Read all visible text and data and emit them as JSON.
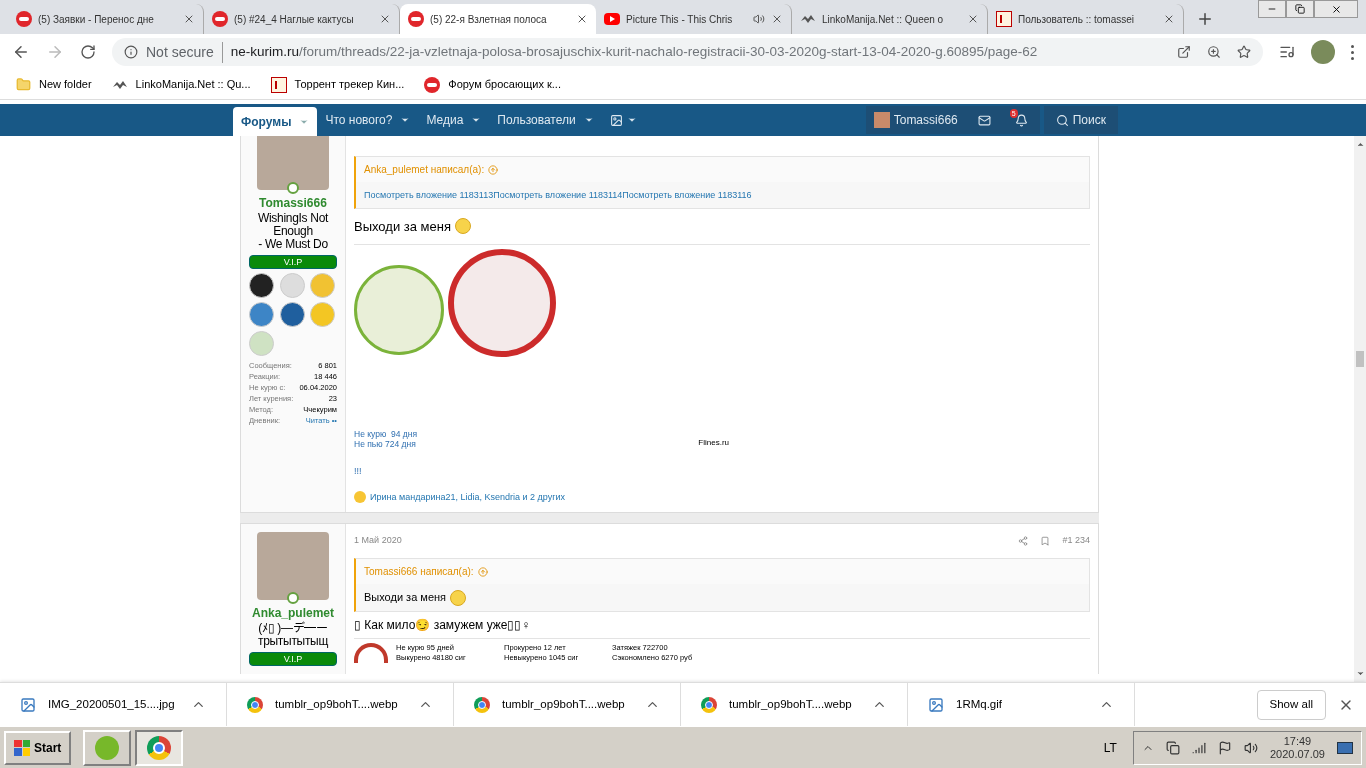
{
  "browser": {
    "tabs": [
      {
        "title": "(5) Заявки - Перенос дне",
        "kind": "forum",
        "selected": false,
        "audio": false
      },
      {
        "title": "(5) #24_4 Наглые кактусы",
        "kind": "forum",
        "selected": false,
        "audio": false
      },
      {
        "title": "(5) 22-я Взлетная полоса",
        "kind": "forum",
        "selected": true,
        "audio": false
      },
      {
        "title": "Picture This - This Chris",
        "kind": "video",
        "selected": false,
        "audio": true
      },
      {
        "title": "LinkoManija.Net :: Queen o",
        "kind": "site",
        "selected": false,
        "audio": false
      },
      {
        "title": "Пользователь :: tomassei",
        "kind": "letter",
        "selected": false,
        "audio": false
      }
    ],
    "security": "Not secure",
    "host": "ne-kurim.ru",
    "path": "/forum/threads/22-ja-vzletnaja-polosa-brosajuschix-kurit-nachalo-registracii-30-03-2020g-start-13-04-2020-g.60895/page-62",
    "bookmarks": [
      {
        "label": "New folder",
        "kind": "folder"
      },
      {
        "label": "LinkoManija.Net :: Qu...",
        "kind": "site"
      },
      {
        "label": "Торрент трекер Кин...",
        "kind": "letter"
      },
      {
        "label": "Форум бросающих к...",
        "kind": "forum"
      }
    ]
  },
  "forum_nav": {
    "items": [
      {
        "label": "Форумы",
        "selected": true
      },
      {
        "label": "Что нового?",
        "selected": false
      },
      {
        "label": "Медиа",
        "selected": false
      },
      {
        "label": "Пользователи",
        "selected": false
      }
    ],
    "user": "Tomassi666",
    "alerts_count": "5",
    "search": "Поиск"
  },
  "posts": [
    {
      "author": {
        "name": "Tomassi666",
        "title_lines": [
          "WishingIs Not Enough",
          "- We Must Do"
        ],
        "badge": "V.I.P",
        "awards": [
          {
            "kind": "hand"
          },
          {
            "kind": "mask"
          },
          {
            "kind": "banana"
          },
          {
            "kind": "person"
          },
          {
            "kind": "megaphone"
          },
          {
            "kind": "medal"
          },
          {
            "kind": "flower"
          }
        ],
        "stats": [
          {
            "label": "Сообщения:",
            "value": "6 801",
            "link": false
          },
          {
            "label": "Реакции:",
            "value": "18 446",
            "link": false
          },
          {
            "label": "Не курю с:",
            "value": "06.04.2020",
            "link": false
          },
          {
            "label": "Лет курения:",
            "value": "23",
            "link": false
          },
          {
            "label": "Метод:",
            "value": "Ччекурим",
            "link": false
          },
          {
            "label": "Дневник:",
            "value": "Читать ••",
            "link": true
          }
        ]
      },
      "quote": {
        "author": "Anka_pulemet написал(а):",
        "body": "Посмотреть вложение 1183113Посмотреть вложение 1183114Посмотреть вложение 1183116",
        "body_link": true
      },
      "text": "Выходи за меня",
      "images": [
        {
          "kind": "cactus"
        },
        {
          "kind": "stamp"
        }
      ],
      "signature": {
        "lines": [
          "Не курю  94 дня",
          "Не пью 724 дня"
        ],
        "site": "Flines.ru"
      },
      "extra": "!!!",
      "reactions": "Ирина мандарина21, Lidia, Ksendria и 2 других"
    },
    {
      "date": "1 Май 2020",
      "number": "#1 234",
      "author": {
        "name": "Anka_pulemet",
        "title_lines": [
          "(ﾒ▯ )—デ━ー",
          "трытытытыщ"
        ],
        "badge": "V.I.P"
      },
      "quote": {
        "author": "Tomassi666 написал(а):",
        "body": "Выходи за меня",
        "body_link": false
      },
      "text": "▯ Как мило😏 замужем уже▯▯♀",
      "counter": [
        [
          "Не курю 95 дней",
          "Выкурено 48180 сиг"
        ],
        [
          "Прокурено 12 лет",
          "Невыкурено 1045 сиг"
        ],
        [
          "Затяжек 722700",
          "Сэкономлено 6270 руб"
        ]
      ]
    }
  ],
  "downloads": {
    "items": [
      {
        "name": "IMG_20200501_15....jpg",
        "kind": "image"
      },
      {
        "name": "tumblr_op9bohT....webp",
        "kind": "chrome"
      },
      {
        "name": "tumblr_op9bohT....webp",
        "kind": "chrome"
      },
      {
        "name": "tumblr_op9bohT....webp",
        "kind": "chrome"
      },
      {
        "name": "1RMq.gif",
        "kind": "image"
      }
    ],
    "show_all": "Show all"
  },
  "taskbar": {
    "start": "Start",
    "language": "LT",
    "time": "17:49",
    "date": "2020.07.09"
  }
}
